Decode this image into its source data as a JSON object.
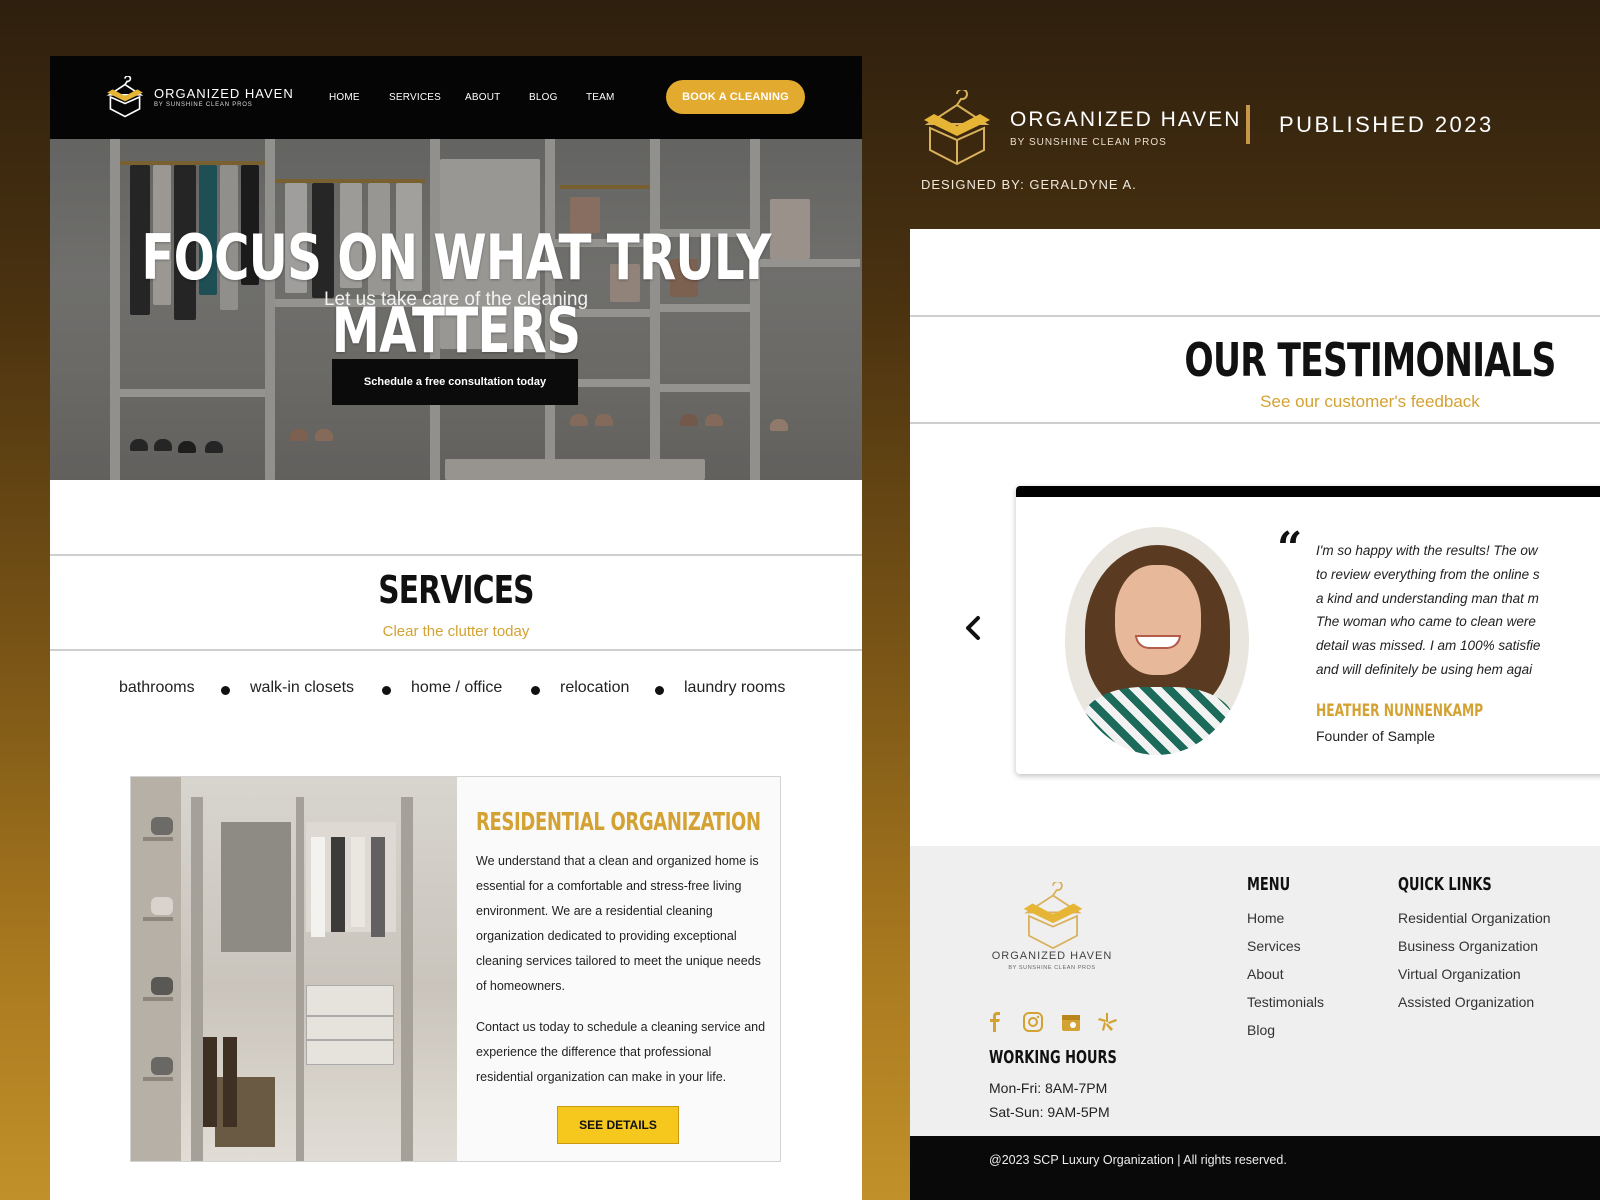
{
  "colors": {
    "gold": "#d4a232",
    "button_gold": "#e2ab2f",
    "black": "#050505",
    "cta_yellow": "#f6c81e"
  },
  "showcase": {
    "brand_name": "ORGANIZED HAVEN",
    "brand_sub": "BY SUNSHINE CLEAN PROS",
    "published": "PUBLISHED 2023",
    "designed_by": "DESIGNED BY: GERALDYNE A."
  },
  "site": {
    "nav": {
      "logo_name": "ORGANIZED HAVEN",
      "logo_sub": "BY SUNSHINE CLEAN PROS",
      "links": [
        "HOME",
        "SERVICES",
        "ABOUT",
        "BLOG",
        "TEAM"
      ],
      "cta": "BOOK A CLEANING"
    },
    "hero": {
      "title": "FOCUS ON WHAT TRULY MATTERS",
      "subtitle": "Let us take care of the cleaning",
      "button": "Schedule a free consultation today"
    },
    "services": {
      "title": "SERVICES",
      "subtitle": "Clear the clutter today",
      "categories": [
        "bathrooms",
        "walk-in closets",
        "home / office",
        "relocation",
        "laundry rooms"
      ],
      "card": {
        "title": "RESIDENTIAL ORGANIZATION",
        "para1": "We understand that a clean and organized home is essential for a comfortable and stress-free living environment. We are a residential cleaning organization dedicated to providing exceptional cleaning services tailored to meet the unique needs of homeowners.",
        "para2": "Contact us today to schedule a cleaning service and experience the difference that professional residential organization can make in your life.",
        "button": "SEE DETAILS"
      }
    },
    "testimonials": {
      "title": "OUR TESTIMONIALS",
      "subtitle": "See our customer's feedback",
      "quote_lines": [
        "I'm so happy with the results! The ow",
        "to review everything from the online s",
        "a kind and understanding man that m",
        "The woman who came to clean were",
        "detail was missed. I am 100% satisfie",
        "and will definitely be using hem agai"
      ],
      "author": "HEATHER NUNNENKAMP",
      "role": "Founder of Sample"
    },
    "footer": {
      "logo_name": "ORGANIZED HAVEN",
      "logo_sub": "BY SUNSHINE CLEAN PROS",
      "social_icons": [
        "facebook-icon",
        "instagram-icon",
        "google-business-icon",
        "yelp-icon"
      ],
      "hours_title": "WORKING HOURS",
      "hours": [
        "Mon-Fri: 8AM-7PM",
        "Sat-Sun: 9AM-5PM"
      ],
      "menu_title": "MENU",
      "menu": [
        "Home",
        "Services",
        "About",
        "Testimonials",
        "Blog"
      ],
      "quick_title": "QUICK LINKS",
      "quick": [
        "Residential Organization",
        "Business Organization",
        "Virtual Organization",
        "Assisted Organization"
      ],
      "copyright": "@2023 SCP Luxury Organization | All rights reserved."
    }
  }
}
